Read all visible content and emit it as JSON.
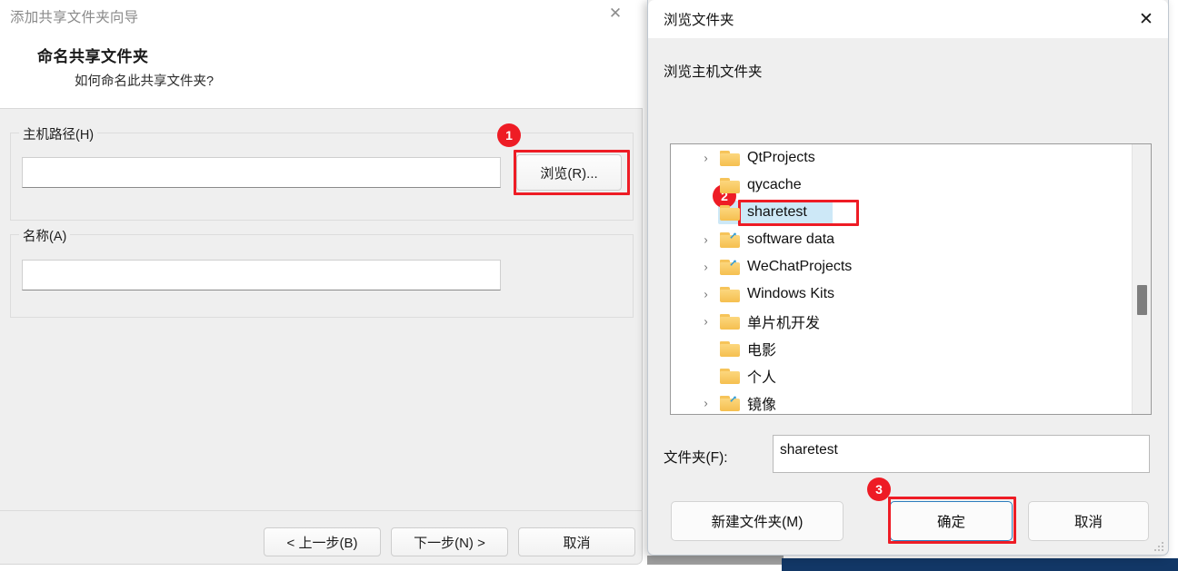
{
  "wizard": {
    "title": "添加共享文件夹向导",
    "close_icon": "✕",
    "heading": "命名共享文件夹",
    "subtitle": "如何命名此共享文件夹?",
    "host_path_group_label": "主机路径(H)",
    "host_path_value": "",
    "host_path_placeholder": "",
    "name_group_label": "名称(A)",
    "name_value": "",
    "name_placeholder": "",
    "browse_button": "浏览(R)...",
    "back_button": "< 上一步(B)",
    "next_button": "下一步(N) >",
    "cancel_button": "取消"
  },
  "dialog": {
    "title": "浏览文件夹",
    "close_icon": "✕",
    "prompt": "浏览主机文件夹",
    "tree": [
      {
        "label": "QtProjects",
        "expandable": true,
        "overlay": false,
        "selected": false
      },
      {
        "label": "qycache",
        "expandable": false,
        "overlay": false,
        "selected": false
      },
      {
        "label": "sharetest",
        "expandable": false,
        "overlay": false,
        "selected": true
      },
      {
        "label": "software data",
        "expandable": true,
        "overlay": true,
        "selected": false
      },
      {
        "label": "WeChatProjects",
        "expandable": true,
        "overlay": true,
        "selected": false
      },
      {
        "label": "Windows Kits",
        "expandable": true,
        "overlay": false,
        "selected": false
      },
      {
        "label": "单片机开发",
        "expandable": true,
        "overlay": false,
        "selected": false
      },
      {
        "label": "电影",
        "expandable": false,
        "overlay": false,
        "selected": false
      },
      {
        "label": "个人",
        "expandable": false,
        "overlay": false,
        "selected": false
      },
      {
        "label": "镜像",
        "expandable": true,
        "overlay": true,
        "selected": false
      }
    ],
    "folder_label": "文件夹(F):",
    "folder_value": "sharetest",
    "folder_placeholder": "",
    "new_folder_button": "新建文件夹(M)",
    "ok_button": "确定",
    "cancel_button": "取消",
    "chevron_icon": "›",
    "resize_grip_icon": "resize-grip"
  },
  "annotations": [
    {
      "badge": "1",
      "target": "浏览(R)..."
    },
    {
      "badge": "2",
      "target": "sharetest"
    },
    {
      "badge": "3",
      "target": "确定"
    }
  ],
  "colors": {
    "annotation_red": "#ee1c25",
    "selection_blue": "#cde8f7",
    "default_button_border": "#2d7dbe",
    "folder_yellow": "#f5bf4f",
    "taskbar_navy": "#123766"
  }
}
